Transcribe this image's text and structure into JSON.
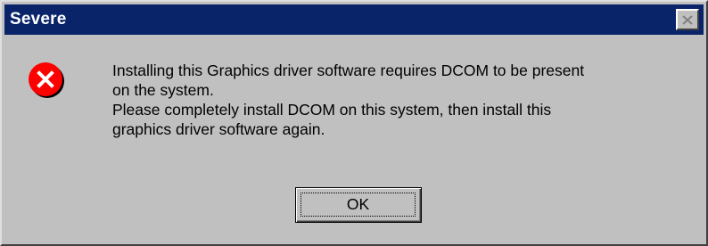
{
  "dialog": {
    "title": "Severe",
    "close_icon": "close-icon",
    "message_icon": "error-icon",
    "colors": {
      "titlebar": "#0a246a",
      "face": "#c0c0c0",
      "error_icon": "#ff0000"
    },
    "message_lines": [
      "Installing this Graphics driver software requires DCOM to be present",
      "on the system.",
      "Please completely install DCOM on this system, then install this",
      "graphics driver software again."
    ],
    "ok_label": "OK"
  }
}
